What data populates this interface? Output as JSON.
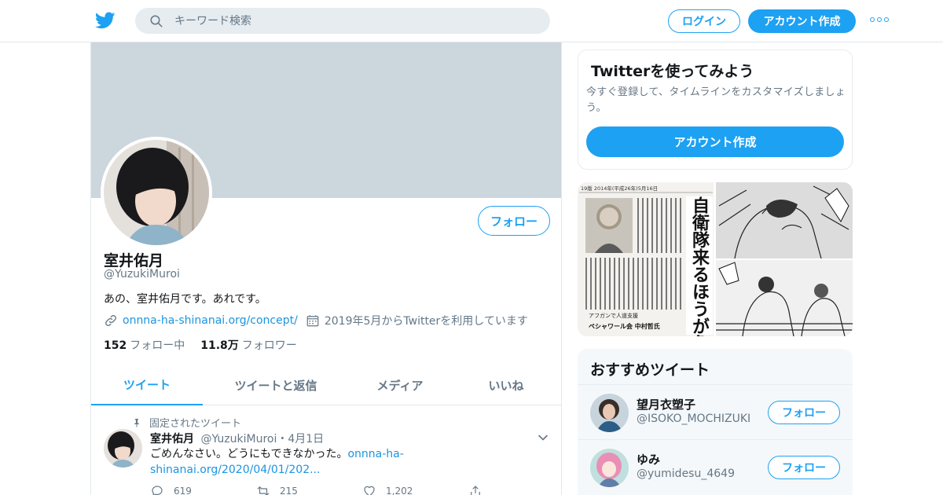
{
  "header": {
    "search": {
      "placeholder": "キーワード検索"
    },
    "login_label": "ログイン",
    "signup_label": "アカウント作成",
    "more_icon": "more-dots-icon"
  },
  "profile": {
    "name": "室井佑月",
    "handle": "@YuzukiMuroi",
    "bio": "あの、室井佑月です。あれです。",
    "link": "onnna-ha-shinanai.org/concept/",
    "joined": "2019年5月からTwitterを利用しています",
    "follow_label": "フォロー",
    "following_count": "152",
    "following_label": "フォロー中",
    "followers_count": "11.8万",
    "followers_label": "フォロワー"
  },
  "tabs": [
    {
      "label": "ツイート"
    },
    {
      "label": "ツイートと返信"
    },
    {
      "label": "メディア"
    },
    {
      "label": "いいね"
    }
  ],
  "pinned_tweet": {
    "pinned_label": "固定されたツイート",
    "name": "室井佑月",
    "handle_date": "@YuzukiMuroi・4月1日",
    "text": "ごめんなさい。どうにもできなかった。",
    "link_text": "onnna-ha-shinanai.org/2020/04/01/202...",
    "replies": "619",
    "retweets": "215",
    "likes": "1,202"
  },
  "join_card": {
    "title": "Twitterを使ってみよう",
    "description": "今すぐ登録して、タイムラインをカスタマイズしましょう。",
    "button_label": "アカウント作成"
  },
  "media": {
    "newspaper_headline": "自衛隊来るほうが危",
    "newspaper_caption": "アフガンで人道支援",
    "newspaper_byline": "ペシャワール会 中村哲氏",
    "newspaper_date": "19版 2014年(平成26年)5月16日"
  },
  "recommended": {
    "title": "おすすめツイート",
    "users": [
      {
        "name": "望月衣塑子",
        "handle": "@ISOKO_MOCHIZUKI",
        "follow_label": "フォロー"
      },
      {
        "name": "ゆみ",
        "handle": "@yumidesu_4649",
        "follow_label": "フォロー"
      }
    ]
  },
  "colors": {
    "brand": "#1da1f2",
    "banner": "#ccd6dd",
    "muted_text": "#657786",
    "link": "#1b95e0"
  }
}
